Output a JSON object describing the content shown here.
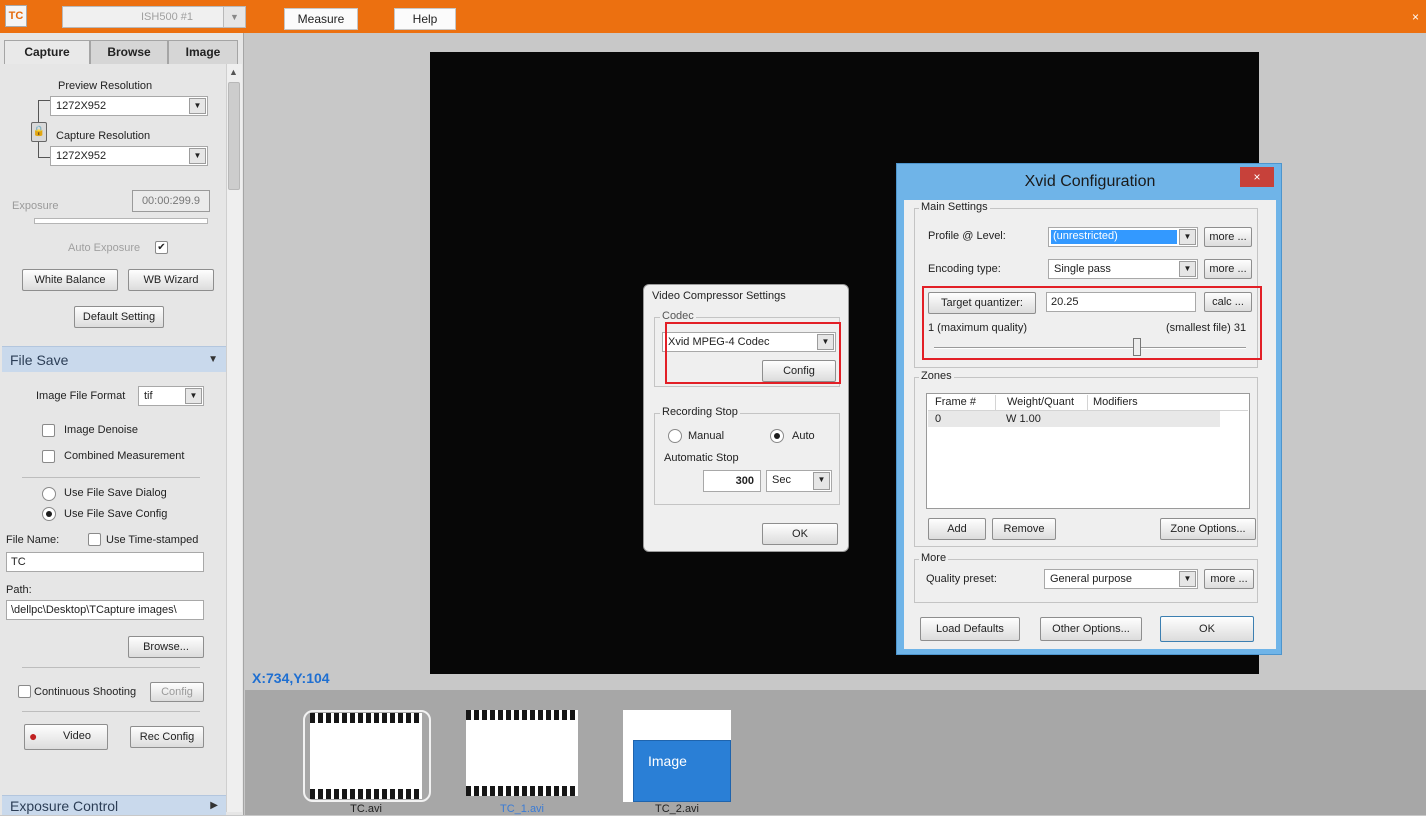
{
  "app": {
    "logo_text": "TC",
    "camera_select": "ISH500 #1",
    "menu": [
      "Measure",
      "Help"
    ],
    "corner_close": "×"
  },
  "tabs": [
    "Capture",
    "Browse",
    "Image"
  ],
  "capture": {
    "preview_resolution_label": "Preview Resolution",
    "preview_resolution_value": "1272X952",
    "capture_resolution_label": "Capture Resolution",
    "capture_resolution_value": "1272X952",
    "exposure_label": "Exposure",
    "exposure_value": "00:00:299.9",
    "auto_exposure_label": "Auto Exposure",
    "white_balance_button": "White Balance",
    "wb_wizard_button": "WB Wizard",
    "default_setting_button": "Default Setting"
  },
  "file_save": {
    "section_title": "File Save",
    "image_file_format_label": "Image File Format",
    "image_file_format_value": "tif",
    "image_denoise_label": "Image Denoise",
    "combined_measurement_label": "Combined Measurement",
    "use_dialog_label": "Use File Save Dialog",
    "use_config_label": "Use File Save Config",
    "file_name_label": "File Name:",
    "use_timestamped_label": "Use Time-stamped",
    "file_name_value": "TC",
    "path_label": "Path:",
    "path_value": "\\dellpc\\Desktop\\TCapture images\\",
    "browse_button": "Browse...",
    "continuous_shooting_label": "Continuous Shooting",
    "config_button": "Config",
    "video_button": "Video",
    "rec_config_button": "Rec Config"
  },
  "exposure_control": {
    "section_title": "Exposure Control"
  },
  "canvas": {
    "coords": "X:734,Y:104"
  },
  "thumbnails": [
    {
      "label": "TC.avi"
    },
    {
      "label": "TC_1.avi"
    },
    {
      "label": "TC_2.avi",
      "inner_text": "Image"
    }
  ],
  "vcs_dialog": {
    "title": "Video Compressor Settings",
    "codec_group": "Codec",
    "codec_value": "Xvid MPEG-4 Codec",
    "config_button": "Config",
    "recording_stop_group": "Recording Stop",
    "manual_label": "Manual",
    "auto_label": "Auto",
    "automatic_stop_label": "Automatic Stop",
    "automatic_stop_value": "300",
    "unit_value": "Sec",
    "ok_button": "OK"
  },
  "xvid_dialog": {
    "title": "Xvid Configuration",
    "close": "×",
    "main_settings_group": "Main Settings",
    "profile_label": "Profile @ Level:",
    "profile_value": "(unrestricted)",
    "encoding_label": "Encoding type:",
    "encoding_value": "Single pass",
    "more_button": "more ...",
    "target_quantizer_button": "Target quantizer:",
    "target_quantizer_value": "20.25",
    "calc_button": "calc ...",
    "quality_left": "1 (maximum quality)",
    "quality_right": "(smallest file) 31",
    "slider_fraction": 0.65,
    "zones_group": "Zones",
    "zones_columns": [
      "Frame #",
      "Weight/Quant",
      "Modifiers"
    ],
    "zones_rows": [
      {
        "frame": "0",
        "weight": "W 1.00",
        "modifiers": ""
      }
    ],
    "add_button": "Add",
    "remove_button": "Remove",
    "zone_options_button": "Zone Options...",
    "more_group": "More",
    "quality_preset_label": "Quality preset:",
    "quality_preset_value": "General purpose",
    "load_defaults_button": "Load Defaults",
    "other_options_button": "Other Options...",
    "ok_button": "OK"
  },
  "colors": {
    "topbar": "#ec7010",
    "highlight_red": "#e21f26",
    "selection_blue": "#3399ff",
    "xvid_frame": "#6fb4e8",
    "coords_blue": "#1f6fd1"
  }
}
